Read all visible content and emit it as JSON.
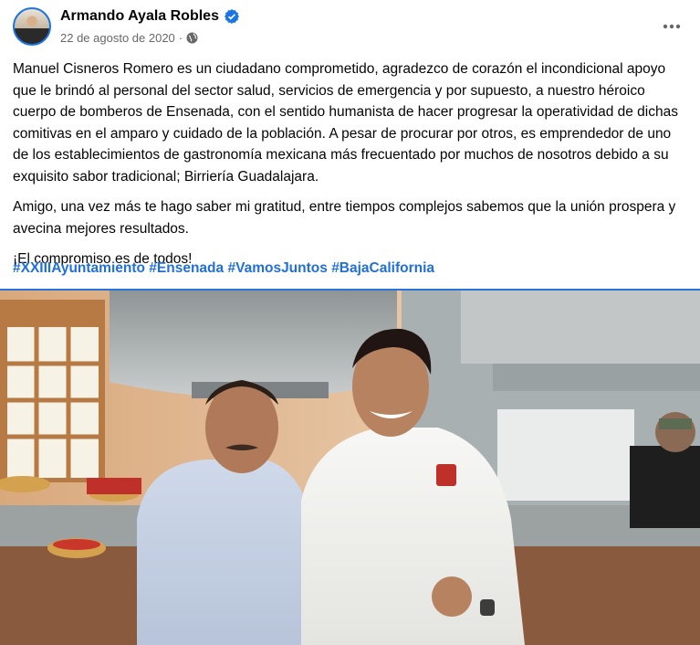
{
  "post": {
    "author": "Armando Ayala Robles",
    "date": "22 de agosto de 2020",
    "separator": "·",
    "paragraphs": [
      "Manuel Cisneros Romero es un ciudadano comprometido, agradezco de corazón el incondicional apoyo que le brindó al personal del sector salud, servicios de emergencia y por supuesto, a nuestro héroico cuerpo de bomberos de Ensenada, con el sentido humanista de hacer progresar la operatividad de dichas comitivas en el amparo y cuidado de la población. A pesar de procurar por otros, es emprendedor de uno de los establecimientos de gastronomía mexicana más frecuentado por muchos de nosotros debido a su exquisito sabor tradicional; Birriería Guadalajara.",
      "Amigo, una vez más te hago saber mi gratitud, entre tiempos complejos sabemos que la unión prospera y avecina mejores resultados.",
      "¡El compromiso es de todos!"
    ],
    "hashtags": [
      "#XXIIIAyuntamiento",
      "#Ensenada",
      "#VamosJuntos",
      "#BajaCalifornia"
    ]
  },
  "icons": {
    "verified": "verified-badge-icon",
    "audience": "globe-icon",
    "more": "more-options-icon"
  },
  "colors": {
    "accent": "#1b74e4",
    "hashtag": "#216fdb",
    "meta": "#65676b",
    "text": "#050505"
  }
}
